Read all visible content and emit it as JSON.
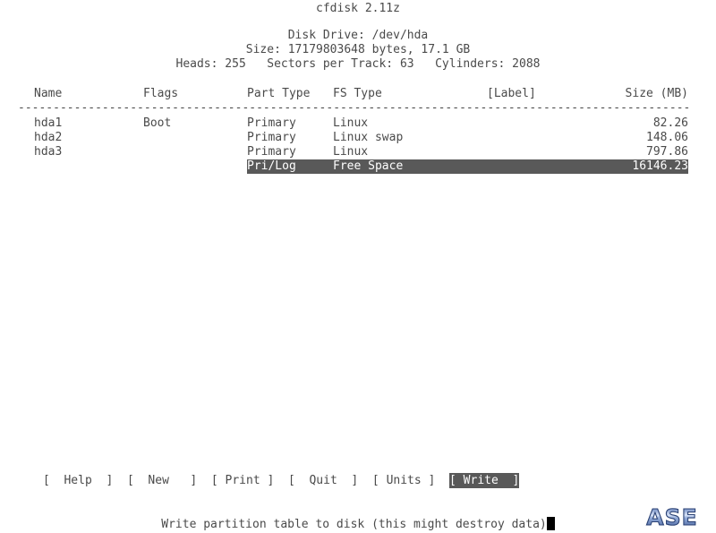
{
  "app": {
    "title": "cfdisk 2.11z"
  },
  "disk_info": {
    "drive_line": "Disk Drive: /dev/hda",
    "size_line": "Size: 17179803648 bytes, 17.1 GB",
    "geometry_line": "Heads: 255   Sectors per Track: 63   Cylinders: 2088",
    "heads": "255",
    "sectors_per_track": "63",
    "cylinders": "2088",
    "size_bytes": "17179803648",
    "size_gb": "17.1 GB",
    "device": "/dev/hda"
  },
  "table": {
    "columns": {
      "name": "Name",
      "flags": "Flags",
      "part_type": "Part Type",
      "fs_type": "FS Type",
      "label": "[Label]",
      "size": "Size (MB)"
    },
    "divider": "------------------------------------------------------------------------------------------------",
    "rows": [
      {
        "name": "hda1",
        "flags": "Boot",
        "part_type": "Primary",
        "fs_type": "Linux",
        "label": "",
        "size": "82.26",
        "selected": false
      },
      {
        "name": "hda2",
        "flags": "",
        "part_type": "Primary",
        "fs_type": "Linux swap",
        "label": "",
        "size": "148.06",
        "selected": false
      },
      {
        "name": "hda3",
        "flags": "",
        "part_type": "Primary",
        "fs_type": "Linux",
        "label": "",
        "size": "797.86",
        "selected": false
      },
      {
        "name": "",
        "flags": "",
        "part_type": "Pri/Log",
        "fs_type": "Free Space",
        "label": "",
        "size": "16146.23",
        "selected": true
      }
    ]
  },
  "menu": {
    "items": [
      {
        "label": "Help",
        "text": "[  Help  ]",
        "selected": false
      },
      {
        "label": "New",
        "text": "[  New   ]",
        "selected": false
      },
      {
        "label": "Print",
        "text": "[ Print ]",
        "selected": false
      },
      {
        "label": "Quit",
        "text": "[  Quit  ]",
        "selected": false
      },
      {
        "label": "Units",
        "text": "[ Units ]",
        "selected": false
      },
      {
        "label": "Write",
        "text": "[ Write  ]",
        "selected": true
      }
    ],
    "separator": " "
  },
  "status": {
    "message": "Write partition table to disk (this might destroy data)"
  },
  "watermark": {
    "text": "ASE",
    "color": "#4a6fbf",
    "highlight": "#b9cdf0"
  },
  "colors": {
    "background": "#ffffff",
    "foreground": "#4a4a4a",
    "highlight_bg": "#595959",
    "highlight_fg": "#ffffff",
    "cursor": "#000000"
  }
}
